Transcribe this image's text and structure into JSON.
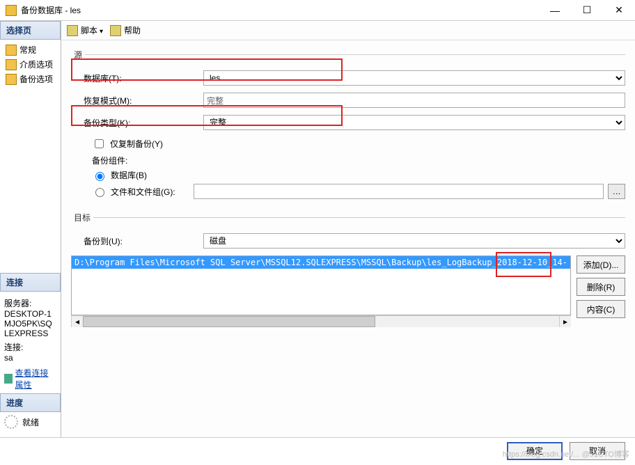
{
  "window": {
    "title": "备份数据库 - les"
  },
  "sidebar": {
    "select_page": "选择页",
    "items": [
      {
        "label": "常规"
      },
      {
        "label": "介质选项"
      },
      {
        "label": "备份选项"
      }
    ],
    "connection": {
      "header": "连接",
      "server_label": "服务器:",
      "server": "DESKTOP-1MJO5PK\\SQLEXPRESS",
      "conn_label": "连接:",
      "conn": "sa",
      "view_props": "查看连接属性"
    },
    "progress": {
      "header": "进度",
      "status": "就绪"
    }
  },
  "toolbar": {
    "script": "脚本",
    "help": "帮助"
  },
  "source": {
    "legend": "源",
    "database_label": "数据库(T):",
    "database_value": "les",
    "recovery_label": "恢复模式(M):",
    "recovery_value": "完整",
    "backup_type_label": "备份类型(K):",
    "backup_type_value": "完整",
    "copy_only": "仅复制备份(Y)",
    "component_label": "备份组件:",
    "radio_db": "数据库(B)",
    "radio_fg": "文件和文件组(G):"
  },
  "dest": {
    "legend": "目标",
    "backup_to_label": "备份到(U):",
    "backup_to_value": "磁盘",
    "path": "D:\\Program Files\\Microsoft SQL Server\\MSSQL12.SQLEXPRESS\\MSSQL\\Backup\\les_LogBackup_2018-12-10_14-",
    "add": "添加(D)...",
    "remove": "删除(R)",
    "contents": "内容(C)"
  },
  "footer": {
    "ok": "确定",
    "cancel": "取消"
  },
  "watermark": "https://blog.csdn.net/... @51CTO博客"
}
